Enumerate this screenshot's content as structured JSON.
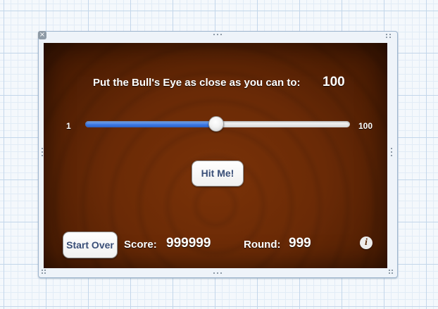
{
  "instruction": {
    "text": "Put the Bull's Eye as close as you can to:",
    "target_value": "100"
  },
  "slider": {
    "min_label": "1",
    "max_label": "100",
    "min": 1,
    "max": 100,
    "value": 50
  },
  "buttons": {
    "hit_me": "Hit Me!",
    "start_over": "Start Over"
  },
  "stats": {
    "score_label": "Score:",
    "score_value": "999999",
    "round_label": "Round:",
    "round_value": "999"
  },
  "info": {
    "glyph": "i"
  },
  "colors": {
    "panel_brown": "#6a2a06",
    "slider_blue": "#3d78e2",
    "button_text": "#3a4f78"
  }
}
